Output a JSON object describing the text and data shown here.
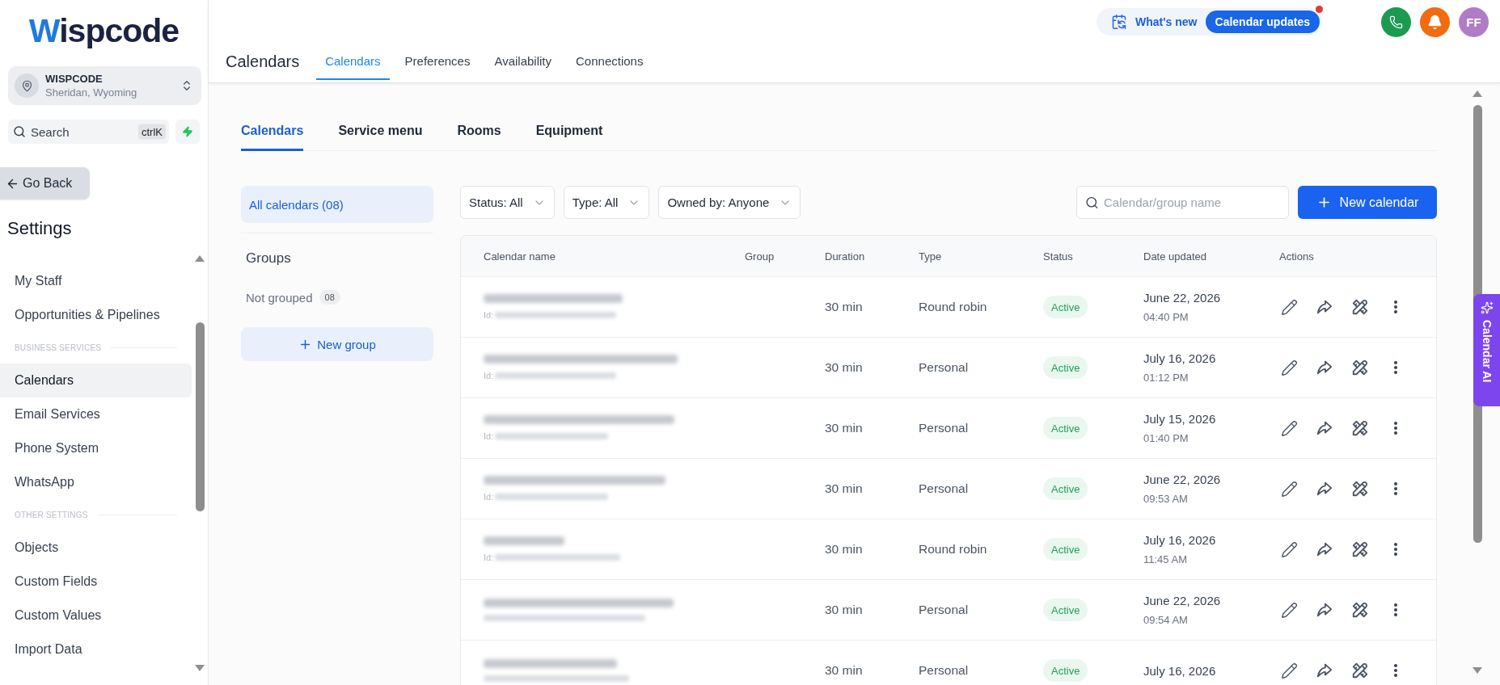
{
  "brand": {
    "name": "Wispcode"
  },
  "account": {
    "name": "WISPCODE",
    "location": "Sheridan, Wyoming"
  },
  "sidebar_search": {
    "placeholder": "Search",
    "shortcut": "ctrlK"
  },
  "go_back": {
    "label": "Go Back"
  },
  "settings": {
    "title": "Settings",
    "menu": [
      {
        "kind": "item",
        "label": "My Staff",
        "selected": false
      },
      {
        "kind": "item",
        "label": "Opportunities & Pipelines",
        "selected": false
      },
      {
        "kind": "section",
        "label": "BUSINESS SERVICES"
      },
      {
        "kind": "item",
        "label": "Calendars",
        "selected": true
      },
      {
        "kind": "item",
        "label": "Email Services",
        "selected": false
      },
      {
        "kind": "item",
        "label": "Phone System",
        "selected": false
      },
      {
        "kind": "item",
        "label": "WhatsApp",
        "selected": false
      },
      {
        "kind": "section",
        "label": "OTHER SETTINGS"
      },
      {
        "kind": "item",
        "label": "Objects",
        "selected": false
      },
      {
        "kind": "item",
        "label": "Custom Fields",
        "selected": false
      },
      {
        "kind": "item",
        "label": "Custom Values",
        "selected": false
      },
      {
        "kind": "item",
        "label": "Import Data",
        "selected": false
      }
    ]
  },
  "whats_new": {
    "label": "What's new",
    "button": "Calendar updates",
    "unread": true
  },
  "user": {
    "initials": "FF"
  },
  "header": {
    "title": "Calendars",
    "tabs": [
      {
        "label": "Calendars",
        "selected": true
      },
      {
        "label": "Preferences",
        "selected": false
      },
      {
        "label": "Availability",
        "selected": false
      },
      {
        "label": "Connections",
        "selected": false
      }
    ]
  },
  "subtabs": [
    {
      "label": "Calendars",
      "selected": true
    },
    {
      "label": "Service menu",
      "selected": false
    },
    {
      "label": "Rooms",
      "selected": false
    },
    {
      "label": "Equipment",
      "selected": false
    }
  ],
  "calendar_views": [
    {
      "label": "All calendars (08)",
      "selected": true
    }
  ],
  "groups": {
    "title": "Groups",
    "items": [
      {
        "name": "Not grouped",
        "count": "08"
      }
    ],
    "new_button": "New group"
  },
  "filters": [
    {
      "label": "Status: All"
    },
    {
      "label": "Type: All"
    },
    {
      "label": "Owned by: Anyone"
    }
  ],
  "table_search": {
    "placeholder": "Calendar/group name"
  },
  "new_calendar": {
    "label": "New calendar"
  },
  "table": {
    "columns": [
      "Calendar name",
      "Group",
      "Duration",
      "Type",
      "Status",
      "Date updated",
      "Actions"
    ],
    "rows": [
      {
        "id_label": "Id:",
        "duration": "30 min",
        "type": "Round robin",
        "status": "Active",
        "date": "June 22, 2026",
        "time": "04:40 PM"
      },
      {
        "id_label": "Id:",
        "duration": "30 min",
        "type": "Personal",
        "status": "Active",
        "date": "July 16, 2026",
        "time": "01:12 PM"
      },
      {
        "id_label": "Id:",
        "duration": "30 min",
        "type": "Personal",
        "status": "Active",
        "date": "July 15, 2026",
        "time": "01:40 PM"
      },
      {
        "id_label": "Id:",
        "duration": "30 min",
        "type": "Personal",
        "status": "Active",
        "date": "June 22, 2026",
        "time": "09:53 AM"
      },
      {
        "id_label": "Id:",
        "duration": "30 min",
        "type": "Round robin",
        "status": "Active",
        "date": "July 16, 2026",
        "time": "11:45 AM"
      },
      {
        "duration": "30 min",
        "type": "Personal",
        "status": "Active",
        "date": "June 22, 2026",
        "time": "09:54 AM"
      },
      {
        "duration": "30 min",
        "type": "Personal",
        "status": "Active",
        "date": "July 16, 2026"
      }
    ]
  },
  "ai_tab": {
    "label": "Calendar AI"
  }
}
